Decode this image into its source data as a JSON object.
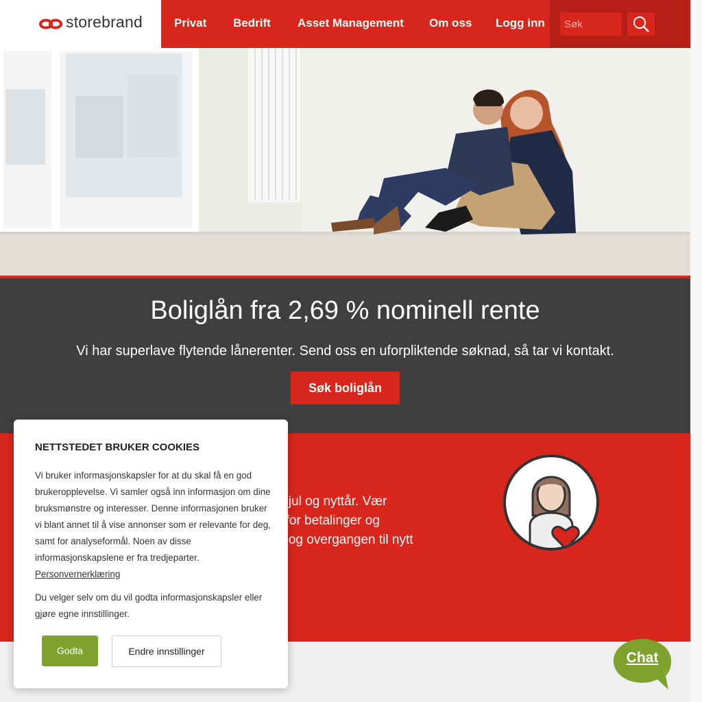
{
  "header": {
    "brand": "storebrand",
    "nav": [
      "Privat",
      "Bedrift",
      "Asset Management",
      "Om oss",
      "Logg inn"
    ],
    "search_placeholder": "Søk",
    "colors": {
      "red": "#d9261c",
      "dark_red": "#b81e18"
    }
  },
  "banner": {
    "title": "Boliglån fra 2,69 % nominell rente",
    "text": "Vi har superlave flytende lånerenter. Send oss en uforpliktende søknad, så tar vi kontakt.",
    "button": "Søk boliglån"
  },
  "red_section": {
    "lines": [
      "d jul og nyttår. Vær",
      "r for betalinger og",
      "n og overgangen til nytt"
    ]
  },
  "cookie": {
    "title": "NETTSTEDET BRUKER COOKIES",
    "body": "Vi bruker informasjonskapsler for at du skal få en god brukeropplevelse. Vi samler også inn informasjon om dine bruksmønstre og interesser. Denne informasjonen bruker vi blant annet til å vise annonser som er relevante for deg, samt for analyseformål. Noen av disse informasjonskapslene er fra tredjeparter.",
    "link": "Personvernerklæring",
    "body2": "Du velger selv om du vil godta informasjonskapsler eller gjøre egne innstillinger.",
    "accept": "Godta",
    "settings": "Endre innstillinger"
  },
  "chat": {
    "label": "Chat",
    "color": "#7ea22e"
  },
  "icons": [
    "storebrand-logo-icon",
    "search-icon",
    "woman-heart-icon",
    "chat-bubble-icon"
  ]
}
